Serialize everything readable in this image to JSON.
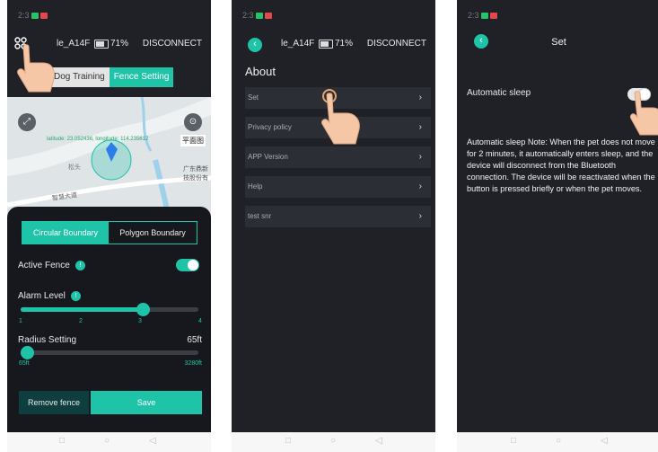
{
  "colors": {
    "accent": "#1fc3a8",
    "background": "#1f2127",
    "sheet": "#16181d",
    "button_dark": "#0f3e3e"
  },
  "system_nav": {
    "icons": [
      "square-icon",
      "circle-icon",
      "triangle-back-icon"
    ],
    "glyphs": [
      "□",
      "○",
      "◁"
    ]
  },
  "screen1": {
    "status_time": "2:3",
    "menu_icon": "grid-menu-icon",
    "device_name": "le_A14F",
    "battery_text": "71%",
    "disconnect_label": "DISCONNECT",
    "tabs": [
      {
        "label": "Dog Training"
      },
      {
        "label": "Fence Setting"
      }
    ],
    "map": {
      "coordinates": "latitude: 23.052436, longitude: 114.235612",
      "map_type_label": "平面图",
      "place_label_1": "松头",
      "place_label_2": "广东鼎新\n技股份有",
      "road_label": "智慧大道"
    },
    "boundary_tabs": [
      {
        "label": "Circular Boundary"
      },
      {
        "label": "Polygon Boundary"
      }
    ],
    "active_fence": {
      "label": "Active Fence",
      "on": true
    },
    "alarm_level": {
      "label": "Alarm Level",
      "value": 3,
      "ticks": [
        "1",
        "2",
        "3",
        "4"
      ]
    },
    "radius": {
      "label": "Radius Setting",
      "value": "65ft",
      "min_label": "65ft",
      "max_label": "3280ft",
      "fraction": 0
    },
    "remove_label": "Remove fence",
    "save_label": "Save"
  },
  "screen2": {
    "status_time": "2:3",
    "device_name": "le_A14F",
    "battery_text": "71%",
    "disconnect_label": "DISCONNECT",
    "title": "About",
    "items": [
      {
        "label": "Set"
      },
      {
        "label": "Privacy policy"
      },
      {
        "label": "APP Version"
      },
      {
        "label": "Help"
      },
      {
        "label": "test snr"
      }
    ]
  },
  "screen3": {
    "status_time": "2:3",
    "title": "Set",
    "sleep_label": "Automatic sleep",
    "sleep_on": true,
    "note": "Automatic sleep Note: When the pet does not move for 2 minutes, it automatically enters sleep, and the device will disconnect from the Bluetooth connection. The device will be reactivated when the button is pressed briefly or when the pet moves."
  }
}
